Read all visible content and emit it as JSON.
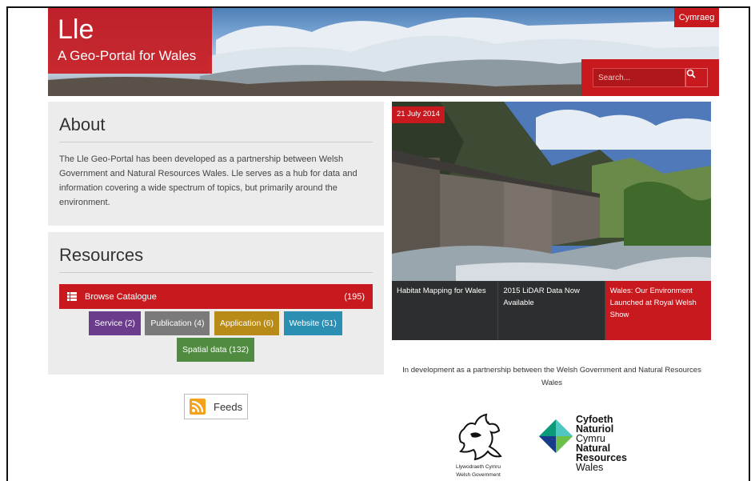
{
  "header": {
    "title": "Lle",
    "subtitle": "A Geo-Portal for Wales",
    "language_button": "Cymraeg",
    "search_placeholder": "Search..."
  },
  "about": {
    "heading": "About",
    "text": "The Lle Geo-Portal has been developed as a partnership between Welsh Government and Natural Resources Wales. Lle serves as a hub for data and information covering a wide spectrum of topics, but primarily around the environment."
  },
  "resources": {
    "heading": "Resources",
    "browse_label": "Browse Catalogue",
    "browse_count": "(195)",
    "tags": [
      {
        "label": "Service (2)",
        "color": "#6b3b8c"
      },
      {
        "label": "Publication (4)",
        "color": "#7a7a7a"
      },
      {
        "label": "Application (6)",
        "color": "#b88b18"
      },
      {
        "label": "Website (51)",
        "color": "#2a8fb3"
      },
      {
        "label": "Spatial data (132)",
        "color": "#4f8c3f"
      }
    ]
  },
  "feeds": {
    "label": "Feeds"
  },
  "news": {
    "date": "21 July 2014",
    "items": [
      {
        "title": "Habitat Mapping for Wales"
      },
      {
        "title": "2015 LiDAR Data Now Available"
      },
      {
        "title": "Wales: Our Environment Launched at Royal Welsh Show"
      }
    ]
  },
  "footer": {
    "development_text": "In development as a partnership between the Welsh Government and Natural Resources Wales",
    "gov_logo_line1": "Llywodraeth Cymru",
    "gov_logo_line2": "Welsh Government",
    "nrw_line1": "Cyfoeth",
    "nrw_line2": "Naturiol",
    "nrw_line3": "Cymru",
    "nrw_line4": "Natural",
    "nrw_line5": "Resources",
    "nrw_line6": "Wales"
  },
  "colors": {
    "brand_red": "#c8191e",
    "panel_grey": "#ececec"
  }
}
